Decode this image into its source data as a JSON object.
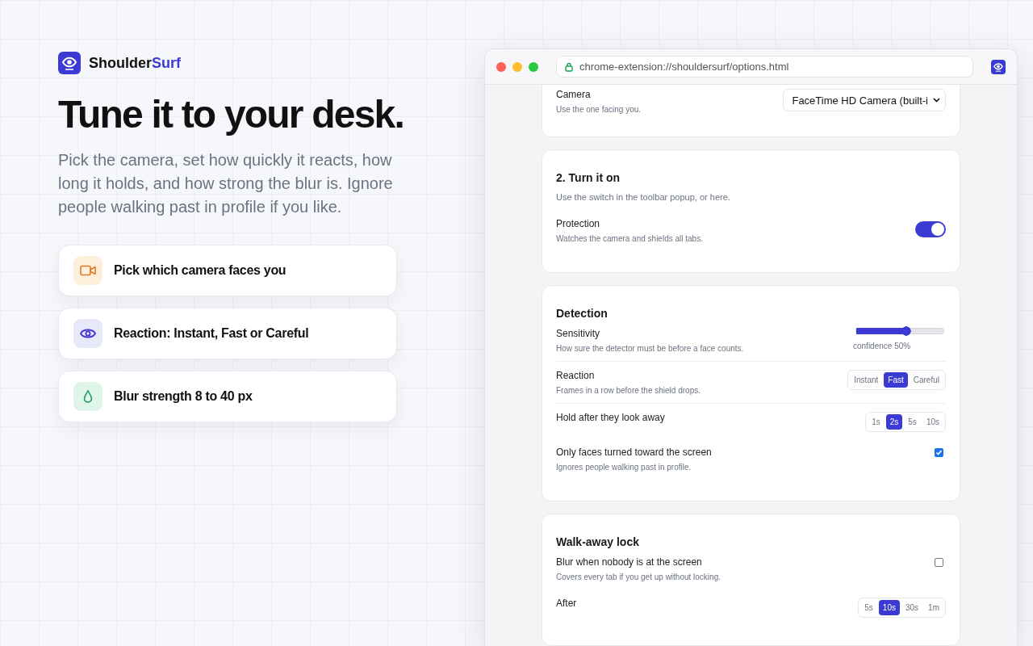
{
  "brand": {
    "name": "Shoulder",
    "accent": "Surf"
  },
  "headline": "Tune it to your desk.",
  "intro": "Pick the camera, set how quickly it reacts, how long it holds, and how strong the blur is. Ignore people walking past in profile if you like.",
  "features": [
    {
      "kind": "camera",
      "text": "Pick which camera faces you"
    },
    {
      "kind": "eye",
      "text": "Reaction: Instant, Fast or Careful"
    },
    {
      "kind": "drop",
      "text": "Blur strength 8 to 40 px"
    }
  ],
  "browser": {
    "url": "chrome-extension://shouldersurf/options.html",
    "sections": [
      {
        "rows": [
          {
            "kind": "select",
            "label": "Camera",
            "desc": "Use the one facing you.",
            "value": "FaceTime HD Camera (built-i"
          }
        ]
      },
      {
        "title": "2. Turn it on",
        "desc": "Use the switch in the toolbar popup, or here.",
        "rows": [
          {
            "kind": "toggle",
            "label": "Protection",
            "desc": "Watches the camera and shields all tabs.",
            "on": true
          }
        ]
      },
      {
        "title": "Detection",
        "rows": [
          {
            "kind": "slider",
            "label": "Sensitivity",
            "desc": "How sure the detector must be before a face counts.",
            "level": 0.63,
            "reading": "confidence 50%",
            "divider": true
          },
          {
            "kind": "segmented",
            "label": "Reaction",
            "desc": "Frames in a row before the shield drops.",
            "divider": true,
            "options": [
              {
                "label": "Instant",
                "selected": false
              },
              {
                "label": "Fast",
                "selected": true
              },
              {
                "label": "Careful",
                "selected": false
              }
            ]
          },
          {
            "kind": "segmented",
            "label": "Hold after they look away",
            "options": [
              {
                "label": "1s",
                "selected": false
              },
              {
                "label": "2s",
                "selected": true
              },
              {
                "label": "5s",
                "selected": false
              },
              {
                "label": "10s",
                "selected": false
              }
            ]
          },
          {
            "kind": "checkbox",
            "label": "Only faces turned toward the screen",
            "desc": "Ignores people walking past in profile.",
            "checked": true
          }
        ]
      },
      {
        "title": "Walk-away lock",
        "rows": [
          {
            "kind": "checkbox",
            "label": "Blur when nobody is at the screen",
            "desc": "Covers every tab if you get up without locking.",
            "checked": false
          },
          {
            "kind": "segmented",
            "label": "After",
            "options": [
              {
                "label": "5s",
                "selected": false
              },
              {
                "label": "10s",
                "selected": true
              },
              {
                "label": "30s",
                "selected": false
              },
              {
                "label": "1m",
                "selected": false
              }
            ]
          }
        ]
      }
    ]
  }
}
